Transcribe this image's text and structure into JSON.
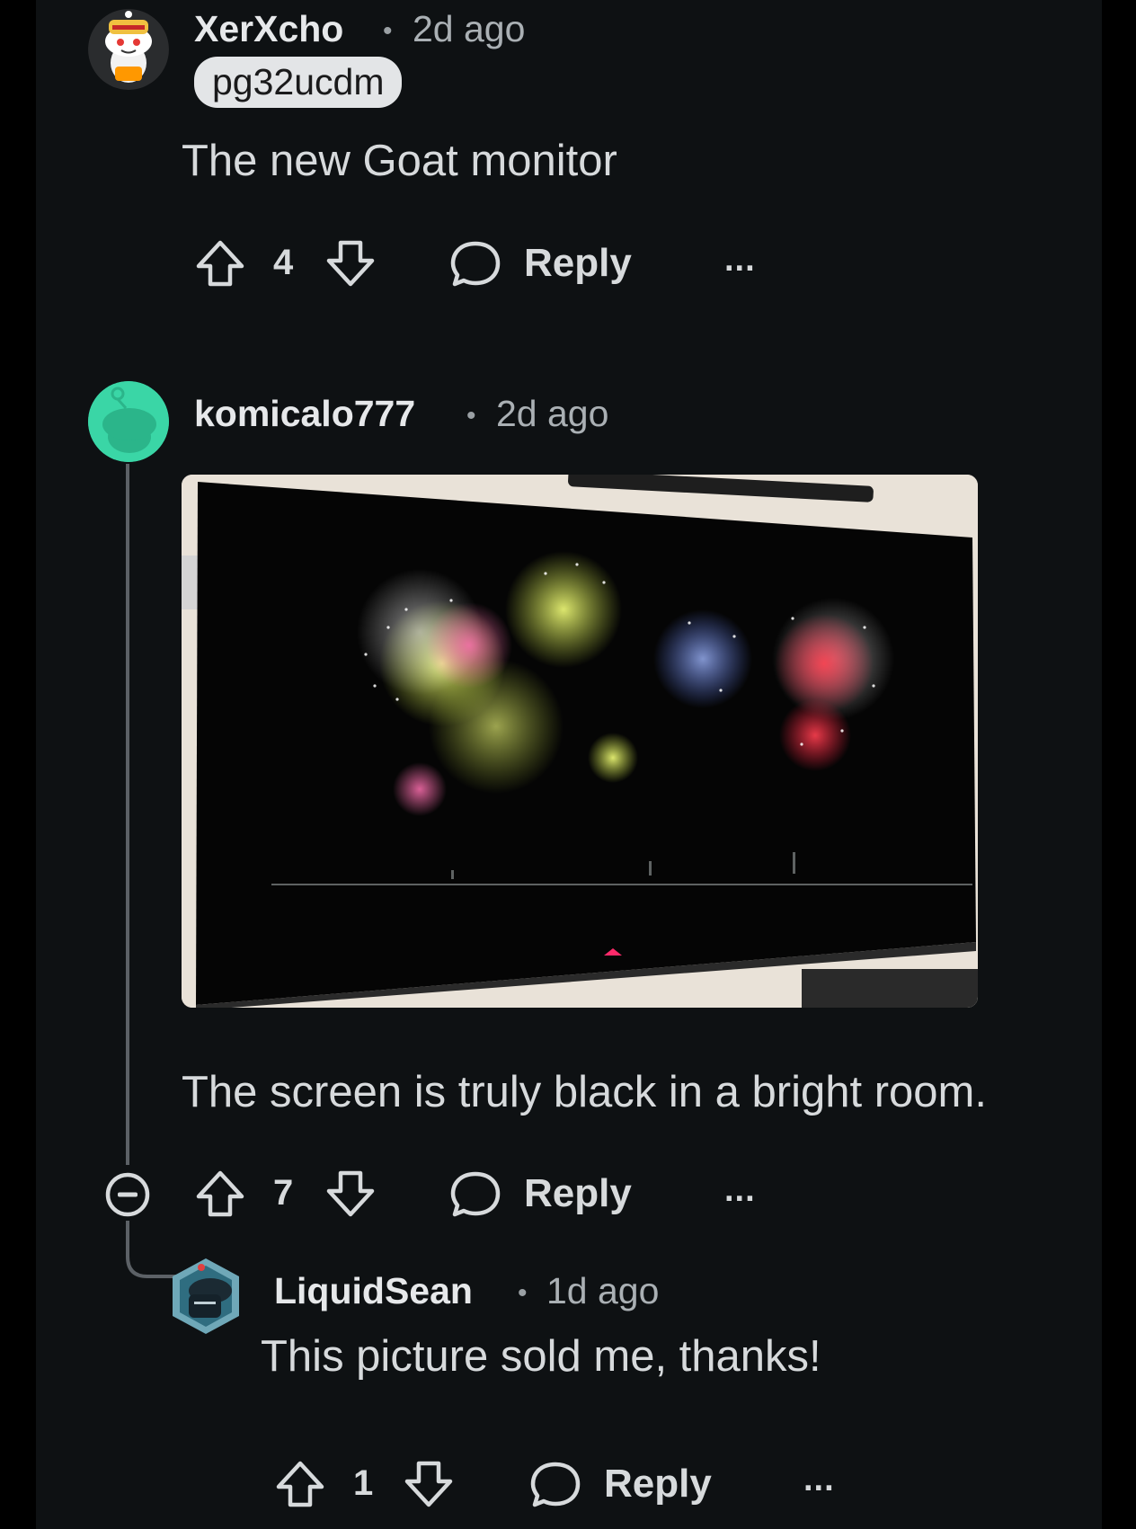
{
  "comments": [
    {
      "username": "XerXcho",
      "separator": "•",
      "time": "2d ago",
      "flair": "pg32ucdm",
      "body": "The new Goat monitor",
      "votes": "4",
      "reply_label": "Reply",
      "more_label": "..."
    },
    {
      "username": "komicalo777",
      "separator": "•",
      "time": "2d ago",
      "body": "The screen is truly black in a bright room.",
      "votes": "7",
      "reply_label": "Reply",
      "more_label": "..."
    },
    {
      "username": "LiquidSean",
      "separator": "•",
      "time": "1d ago",
      "body": "This picture sold me, thanks!",
      "votes": "1",
      "reply_label": "Reply",
      "more_label": "..."
    }
  ],
  "icons": {
    "upvote": "arrow-up-outline",
    "downvote": "arrow-down-outline",
    "reply": "speech-bubble-outline",
    "collapse": "circle-minus",
    "more": "ellipsis"
  },
  "colors": {
    "background": "#0e1113",
    "text": "#d7dadc",
    "flair_bg": "#e3e5e7",
    "avatar_teal": "#3ad6a6",
    "firework_red": "#ff3a4a",
    "firework_yellow": "#e8f060",
    "firework_blue": "#8aa6ff"
  }
}
